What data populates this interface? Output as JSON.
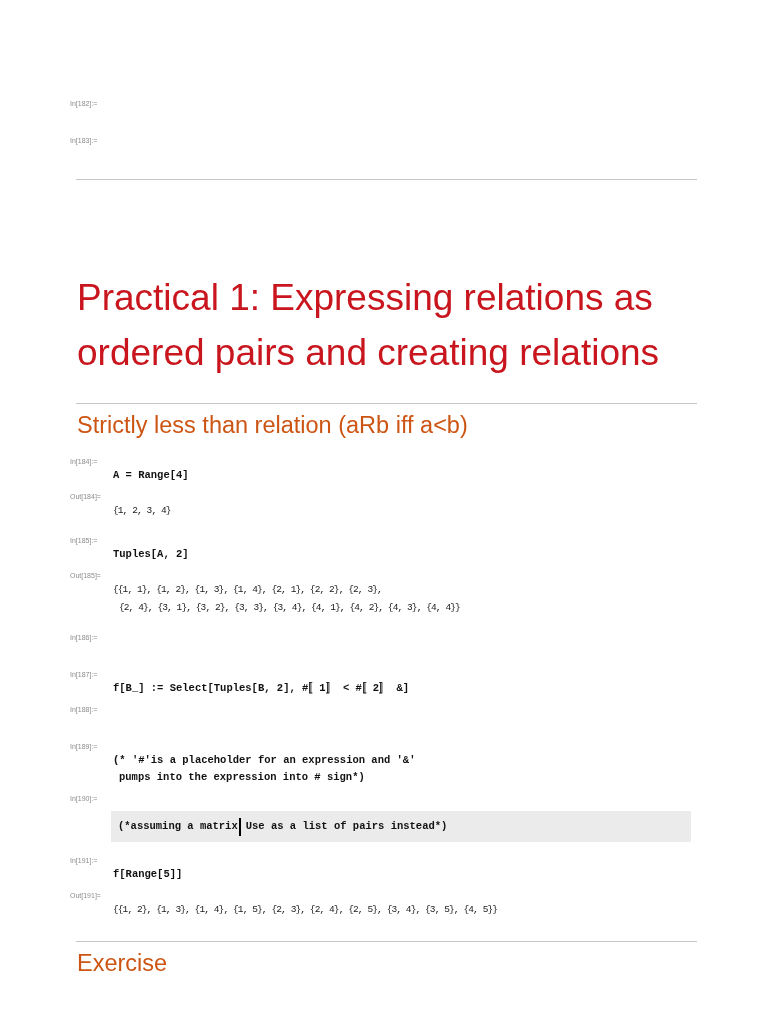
{
  "notebook": {
    "cells": [
      {
        "kind": "input",
        "label": "In[182]:=",
        "selected": false
      },
      {
        "kind": "input",
        "label": "In[183]:=",
        "selected": false
      },
      {
        "kind": "divider"
      },
      {
        "kind": "title",
        "text": "Practical 1: Expressing relations as ordered pairs and creating relations"
      },
      {
        "kind": "divider"
      },
      {
        "kind": "section",
        "text": "Strictly less than relation (aRb iff a<b)"
      },
      {
        "kind": "input",
        "label": "In[184]:=",
        "selected": false,
        "lines": [
          "A = Range[4]"
        ]
      },
      {
        "kind": "output",
        "label": "Out[184]=",
        "selected": false,
        "lines": [
          "{1, 2, 3, 4}"
        ]
      },
      {
        "kind": "input",
        "label": "In[185]:=",
        "selected": false,
        "lines": [
          "Tuples[A, 2]"
        ]
      },
      {
        "kind": "output",
        "label": "Out[185]=",
        "selected": false,
        "lines": [
          "{{1, 1}, {1, 2}, {1, 3}, {1, 4}, {2, 1}, {2, 2}, {2, 3},",
          "{2, 4}, {3, 1}, {3, 2}, {3, 3}, {3, 4}, {4, 1}, {4, 2}, {4, 3}, {4, 4}}"
        ]
      },
      {
        "kind": "input",
        "label": "In[186]:=",
        "selected": false
      },
      {
        "kind": "input",
        "label": "In[187]:=",
        "selected": false,
        "lines": [
          "f[B_] := Select[Tuples[B, 2], #〚1〛 < #〚2〛 &]"
        ]
      },
      {
        "kind": "input",
        "label": "In[188]:=",
        "selected": false
      },
      {
        "kind": "input",
        "label": "In[189]:=",
        "selected": false,
        "lines": [
          "(* '#'is a placeholder for an expression and '&'",
          "pumps into the expression into # sign*)"
        ]
      },
      {
        "kind": "input",
        "label": "In[190]:=",
        "selected": true,
        "lines": [
          "(*assuming a matrix"
        ],
        "after_cursor": "Use as a list of pairs instead*)"
      },
      {
        "kind": "input",
        "label": "In[191]:=",
        "selected": false,
        "lines": [
          "f[Range[5]]"
        ]
      },
      {
        "kind": "output",
        "label": "Out[191]=",
        "selected": false,
        "lines": [
          "{{1, 2}, {1, 3}, {1, 4}, {1, 5}, {2, 3}, {2, 4}, {2, 5}, {3, 4}, {3, 5}, {4, 5}}"
        ]
      },
      {
        "kind": "divider"
      },
      {
        "kind": "section",
        "text": "Exercise"
      }
    ]
  }
}
